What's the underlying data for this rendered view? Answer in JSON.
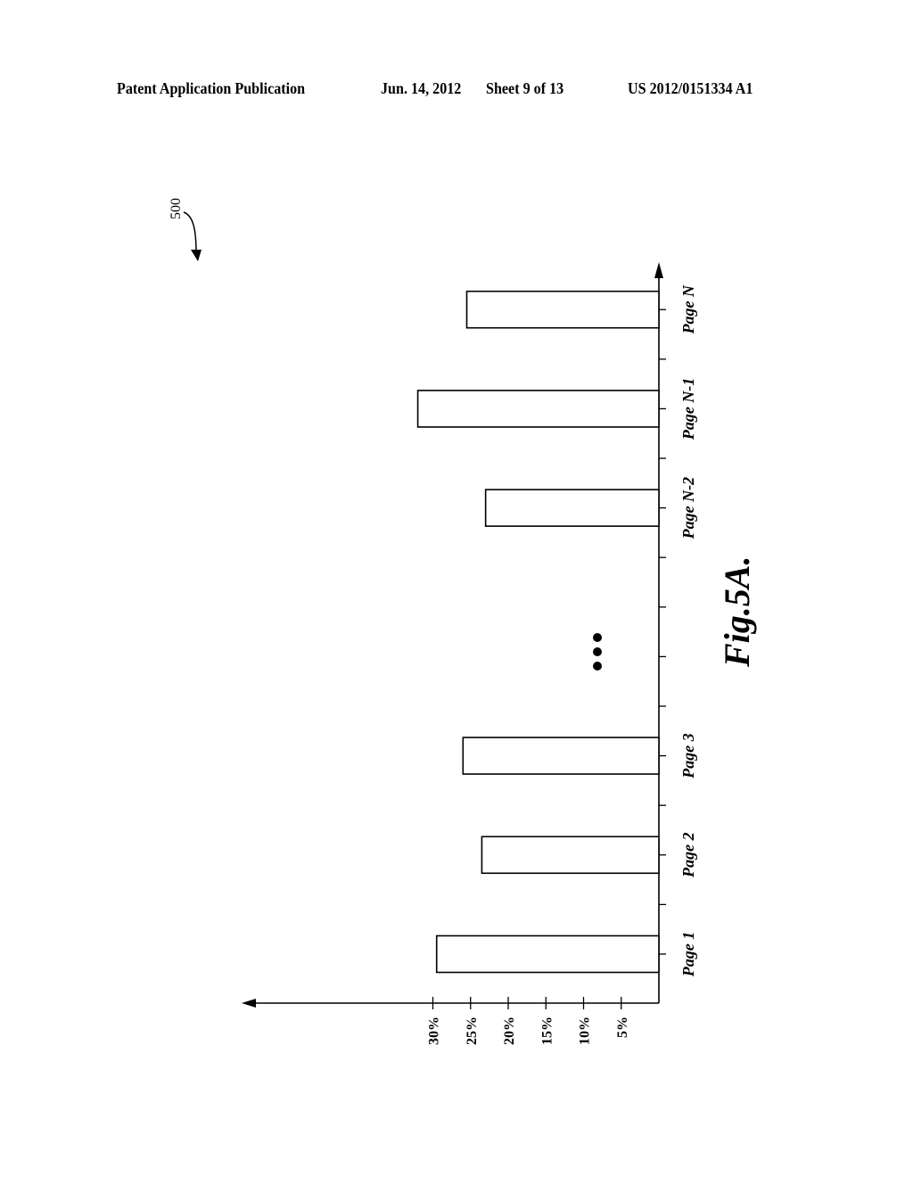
{
  "header": {
    "left": "Patent Application Publication",
    "date": "Jun. 14, 2012",
    "sheet": "Sheet 9 of 13",
    "publication_number": "US 2012/0151334 A1"
  },
  "figure": {
    "reference_numeral": "500",
    "caption": "Fig.5A.",
    "ellipsis_icon": "vertical-ellipsis-dots",
    "orientation": "rotated 90° counter-clockwise (landscape figure on portrait sheet)"
  },
  "chart_data": {
    "type": "bar",
    "title": "",
    "xlabel": "",
    "ylabel": "",
    "categories": [
      "Page 1",
      "Page 2",
      "Page 3",
      "Page N-2",
      "Page N-1",
      "Page N"
    ],
    "gap_after_index": 2,
    "values": [
      29.5,
      23.5,
      26,
      23,
      32,
      25.5
    ],
    "value_unit": "%",
    "ylim": [
      0,
      35
    ],
    "value_ticks": [
      5,
      10,
      15,
      20,
      25,
      30
    ],
    "value_tick_labels": [
      "5%",
      "10%",
      "15%",
      "20%",
      "25%",
      "30%"
    ],
    "grid": false,
    "legend": "none",
    "bar_fill": "#ffffff",
    "bar_stroke": "#000000"
  }
}
